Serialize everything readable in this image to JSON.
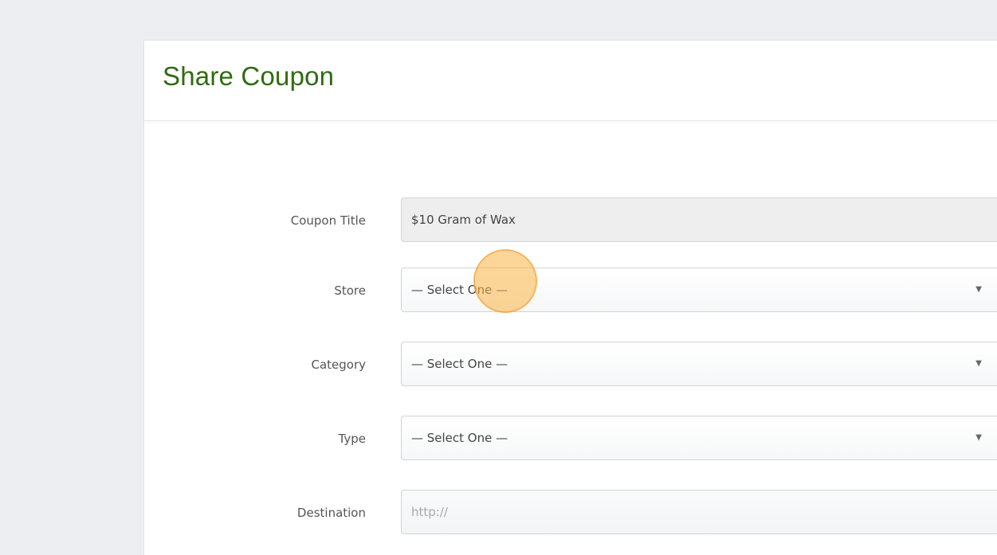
{
  "panel": {
    "title": "Share Coupon"
  },
  "form": {
    "coupon_title": {
      "label": "Coupon Title",
      "value": "$10 Gram of Wax"
    },
    "store": {
      "label": "Store",
      "value": "— Select One —"
    },
    "category": {
      "label": "Category",
      "value": "— Select One —"
    },
    "type": {
      "label": "Type",
      "value": "— Select One —"
    },
    "destination": {
      "label": "Destination",
      "placeholder": "http://"
    }
  },
  "icons": {
    "dropdown": "caret-down-icon"
  },
  "colors": {
    "title": "#2f6b12",
    "click_indicator": "#f5b041"
  }
}
